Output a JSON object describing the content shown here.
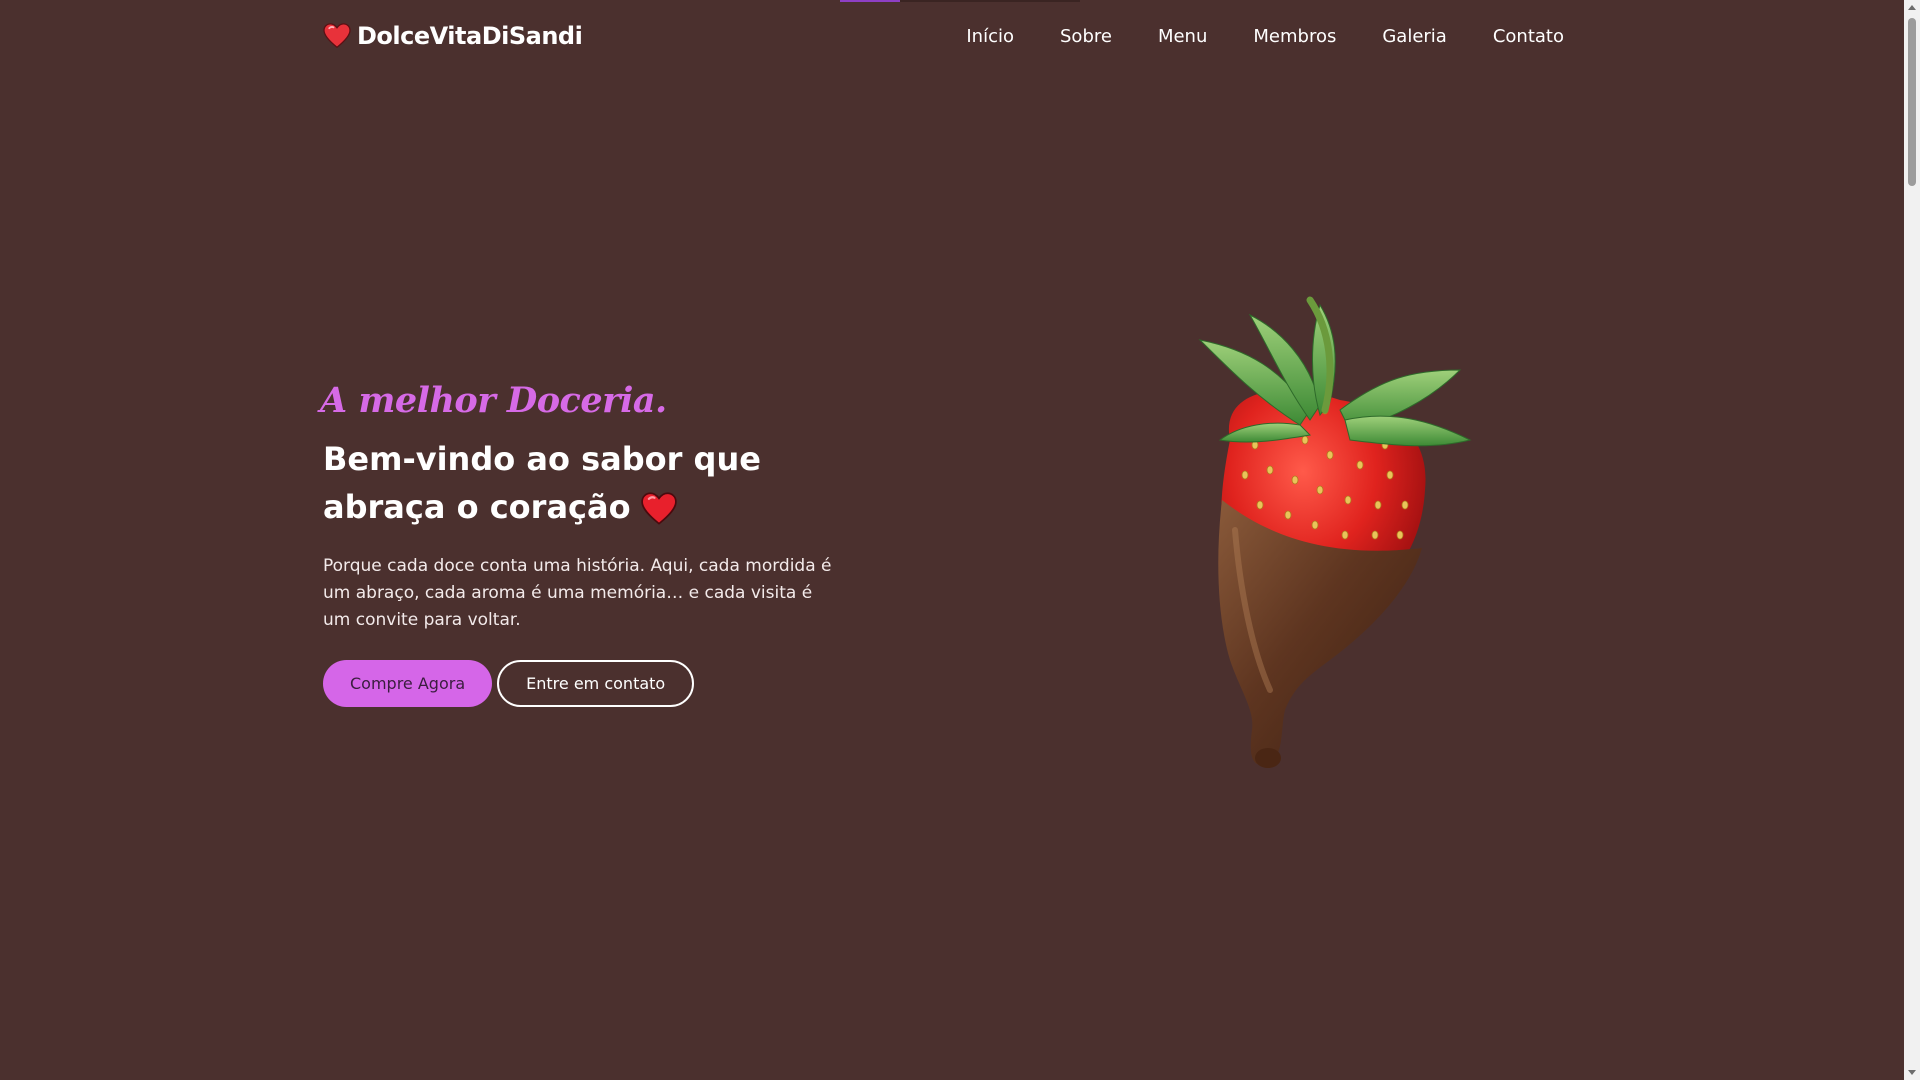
{
  "progress": {
    "fraction": 0.25,
    "color": "#8e3fc4"
  },
  "brand": {
    "name": "DolceVitaDiSandi",
    "icon": "heart-icon",
    "heart_color": "#e8323a"
  },
  "nav": {
    "items": [
      {
        "label": "Início"
      },
      {
        "label": "Sobre"
      },
      {
        "label": "Menu"
      },
      {
        "label": "Membros"
      },
      {
        "label": "Galeria"
      },
      {
        "label": "Contato"
      }
    ]
  },
  "hero": {
    "tagline": "A melhor Doceria.",
    "headline_line1": "Bem-vindo ao sabor que",
    "headline_line2": "abraça o coração",
    "headline_icon": "heart-icon",
    "description": "Porque cada doce conta uma história. Aqui, cada mordida é um abraço, cada aroma é uma memória… e cada visita é um convite para voltar.",
    "primary_button": "Compre Agora",
    "secondary_button": "Entre em contato",
    "image": "chocolate-dipped-strawberry"
  },
  "colors": {
    "background": "#4b302e",
    "accent": "#d566e8",
    "text": "#ffffff"
  }
}
